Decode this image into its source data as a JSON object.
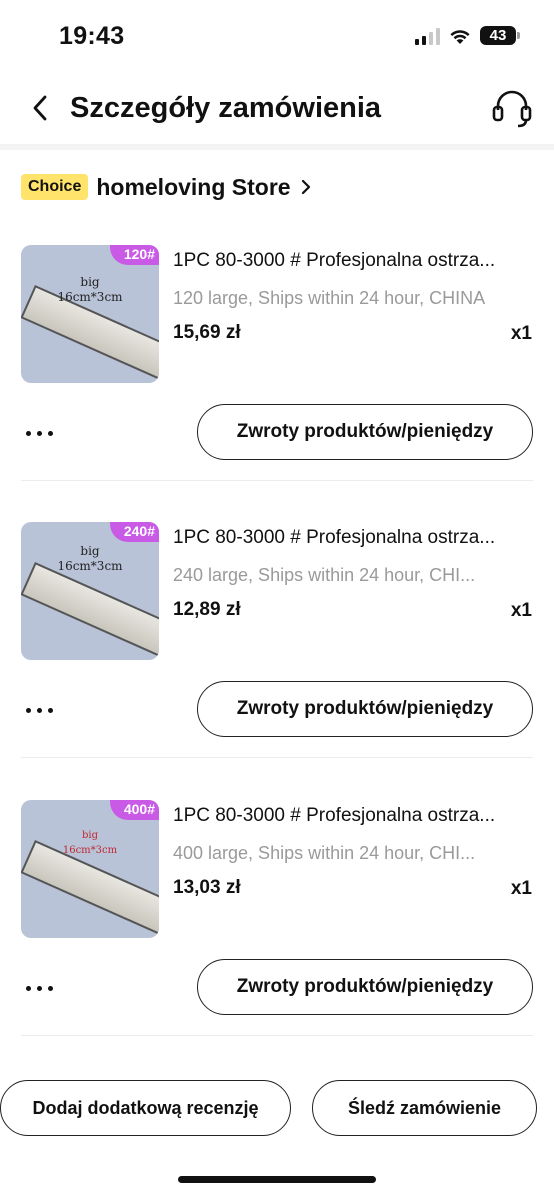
{
  "status_bar": {
    "time": "19:43",
    "battery": "43"
  },
  "header": {
    "title": "Szczegóły zamówienia"
  },
  "store": {
    "badge": "Choice",
    "name": "homeloving Store"
  },
  "items": [
    {
      "tag": "120#",
      "thumb_text": "big\n16cm*3cm",
      "title": "1PC 80-3000 # Profesjonalna ostrza...",
      "variant": "120 large, Ships within 24 hour, CHINA",
      "price": "15,69 zł",
      "qty": "x1",
      "refund_label": "Zwroty produktów/pieniędzy"
    },
    {
      "tag": "240#",
      "thumb_text": "big\n16cm*3cm",
      "title": "1PC 80-3000 # Profesjonalna ostrza...",
      "variant": "240 large, Ships within 24 hour, CHI...",
      "price": "12,89 zł",
      "qty": "x1",
      "refund_label": "Zwroty produktów/pieniędzy"
    },
    {
      "tag": "400#",
      "thumb_text": "big\n16cm*3cm",
      "title": "1PC 80-3000 # Profesjonalna ostrza...",
      "variant": "400 large, Ships within 24 hour, CHI...",
      "price": "13,03 zł",
      "qty": "x1",
      "refund_label": "Zwroty produktów/pieniędzy"
    }
  ],
  "bottom": {
    "review_label": "Dodaj dodatkową recenzję",
    "track_label": "Śledź zamówienie"
  },
  "colors": {
    "choice_badge": "#ffe36b",
    "tag": "#c85ae6",
    "text": "#111111",
    "muted": "#9a9a9a"
  }
}
